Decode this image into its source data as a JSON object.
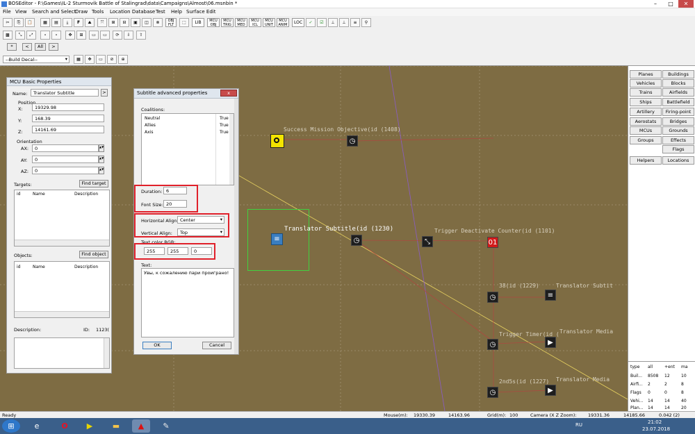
{
  "window": {
    "title": "BOSEditor - F:\\Games\\IL-2 Sturmovik Battle of Stalingrad\\data\\Campaigns\\Almost\\06.msnbin *",
    "minimize": "–",
    "maximize": "□",
    "close": "✕"
  },
  "menu": [
    "File",
    "View",
    "Search and Select",
    "Draw",
    "Tools",
    "Location Database",
    "Test",
    "Help",
    "Surface Edit"
  ],
  "toolbar": {
    "f_button": "F",
    "obj_button": "OBJ\nFLT",
    "lib_button": "LIB",
    "mcu_buttons": [
      "MCU\nOBJ",
      "MCU\nTRIG",
      "MCU\nMED",
      "MCU\nICL",
      "MCU\nUNIT",
      "MCU\nANIM"
    ],
    "loc_button": "LOC",
    "filter_star": "*",
    "filter_all": "All",
    "decal_select": "--Build Decal--"
  },
  "mcu_panel": {
    "title": "MCU Basic Properties",
    "name_label": "Name:",
    "name_value": "Translator Subtitle",
    "name_btn": ">",
    "position_label": "Position",
    "x_label": "X:",
    "x_value": "19329.98",
    "y_label": "Y:",
    "y_value": "168.39",
    "z_label": "Z:",
    "z_value": "14161.69",
    "orientation_label": "Orientation",
    "ax_label": "AX:",
    "ax_value": "0",
    "ay_label": "AY:",
    "ay_value": "0",
    "az_label": "AZ:",
    "az_value": "0",
    "targets_label": "Targets:",
    "find_target": "Find target",
    "objects_label": "Objects:",
    "find_object": "Find object",
    "col_id": "id",
    "col_name": "Name",
    "col_desc": "Description",
    "description_label": "Description:",
    "id_label": "ID:",
    "id_value": "1123("
  },
  "subtitle_dialog": {
    "title": "Subtitle advanced properties",
    "close": "x",
    "coalitions_label": "Coalitions:",
    "coalitions": [
      {
        "name": "Neutral",
        "value": "True"
      },
      {
        "name": "Allies",
        "value": "True"
      },
      {
        "name": "Axis",
        "value": "True"
      }
    ],
    "duration_label": "Duration:",
    "duration_value": "6",
    "font_size_label": "Font Size:",
    "font_size_value": "20",
    "halign_label": "Horizontal Align:",
    "halign_value": "Center",
    "valign_label": "Vertical Align:",
    "valign_value": "Top",
    "color_label": "Text color RGB:",
    "r": "255",
    "g": "255",
    "b": "0",
    "text_label": "Text:",
    "text_value": "Увы, к сожалению пари проиграно!",
    "ok": "OK",
    "cancel": "Cancel"
  },
  "map_labels": {
    "success": "Success Mission Objective(id (1408)",
    "translator1": "Translator Subtitle(id (1230)",
    "deactivate": "Trigger Deactivate Counter(id (1101)",
    "id1229": "38(id (1229)",
    "translator2": "Translator Subtit",
    "timer": "Trigger Timer(id (",
    "translator_media": "Translator Media",
    "id1227": "2nd5s(id (1227)",
    "translator_media2": "Translator Media"
  },
  "palette": {
    "rows": [
      [
        "Planes",
        "Buildings"
      ],
      [
        "Vehicles",
        "Blocks"
      ],
      [
        "Trains",
        "Airfields"
      ],
      [
        "Ships",
        "Battlefield"
      ],
      [
        "Artillery",
        "Firing-point"
      ],
      [
        "Aerostats",
        "Bridges"
      ],
      [
        "MCUs",
        "Grounds"
      ],
      [
        "Groups",
        "Effects"
      ],
      [
        "",
        "Flags"
      ],
      [
        "Helpers",
        "Locations"
      ]
    ]
  },
  "stats": {
    "headers": [
      "type",
      "all",
      "+ent",
      "ma"
    ],
    "rows": [
      [
        "Buil...",
        "8508",
        "12",
        "10"
      ],
      [
        "Airfi...",
        "2",
        "2",
        "8"
      ],
      [
        "Flags",
        "0",
        "0",
        "8"
      ],
      [
        "Vehi...",
        "14",
        "14",
        "40"
      ],
      [
        "Plan...",
        "14",
        "14",
        "20"
      ]
    ]
  },
  "status": {
    "ready": "Ready",
    "mouse_label": "Mouse(m):",
    "mouse_x": "19330.39",
    "mouse_z": "14163.96",
    "grid_label": "Grid(m):",
    "grid_value": "100",
    "camera_label": "Camera (X Z Zoom):",
    "cam_x": "19331.36",
    "cam_z": "14185.66",
    "zoom": "0.042 (2)"
  },
  "taskbar": {
    "lang": "RU",
    "time": "21:02",
    "date": "23.07.2018"
  },
  "colors": {
    "accent_red": "#e0202a",
    "map": "#7e6c43",
    "taskbar": "#3a5f8a"
  }
}
